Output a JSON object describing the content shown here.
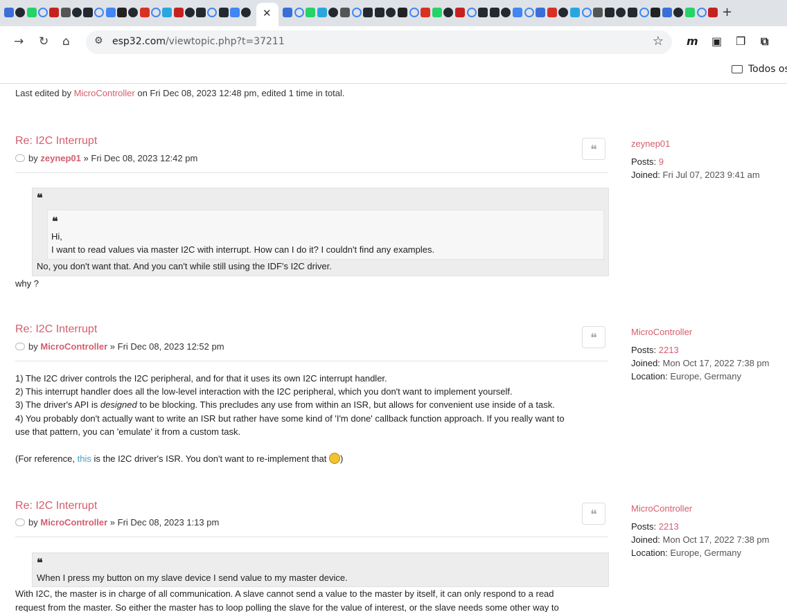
{
  "browser": {
    "active_tab_close": "✕",
    "new_tab": "+",
    "url_host": "esp32.com",
    "url_path": "/viewtopic.php?t=37211",
    "bookmark_folder": "Todos os"
  },
  "top_note": {
    "prefix": "Last edited by",
    "author": "MicroController",
    "suffix": "on Fri Dec 08, 2023 12:48 pm, edited 1 time in total."
  },
  "posts": [
    {
      "title": "Re: I2C Interrupt",
      "by": "by",
      "author": "zeynep01",
      "date": "» Fri Dec 08, 2023 12:42 pm",
      "profile": {
        "name": "zeynep01",
        "posts_label": "Posts:",
        "posts": "9",
        "joined_label": "Joined:",
        "joined": "Fri Jul 07, 2023 9:41 am"
      },
      "outer_quote_last": "No, you don't want that. And you can't while still using the IDF's I2C driver.",
      "inner_quote": [
        "Hi,",
        "I want to read values via master I2C with interrupt. How can I do it? I couldn't find any examples."
      ],
      "body": "why ?"
    },
    {
      "title": "Re: I2C Interrupt",
      "by": "by",
      "author": "MicroController",
      "date": "» Fri Dec 08, 2023 12:52 pm",
      "profile": {
        "name": "MicroController",
        "posts_label": "Posts:",
        "posts": "2213",
        "joined_label": "Joined:",
        "joined": "Mon Oct 17, 2022 7:38 pm",
        "location_label": "Location:",
        "location": "Europe, Germany"
      },
      "lines": [
        "1) The I2C driver controls the I2C peripheral, and for that it uses its own I2C interrupt handler.",
        "2) This interrupt handler does all the low-level interaction with the I2C peripheral, which you don't want to implement yourself.",
        "4) You probably don't actually want to write an ISR but rather have some kind of 'I'm done' callback function approach. If you really want to",
        "use that pattern, you can 'emulate' it from a custom task."
      ],
      "line3_a": "3) The driver's API is",
      "line3_em": "designed",
      "line3_b": "to be blocking. This precludes any use from within an ISR, but allows for convenient use inside of a task.",
      "ref_a": "(For reference,",
      "ref_link": "this",
      "ref_b": "is the I2C driver's ISR. You don't want to re-implement that",
      "ref_end": ")"
    },
    {
      "title": "Re: I2C Interrupt",
      "by": "by",
      "author": "MicroController",
      "date": "» Fri Dec 08, 2023 1:13 pm",
      "profile": {
        "name": "MicroController",
        "posts_label": "Posts:",
        "posts": "2213",
        "joined_label": "Joined:",
        "joined": "Mon Oct 17, 2022 7:38 pm",
        "location_label": "Location:",
        "location": "Europe, Germany"
      },
      "quote": "When I press my button on my slave device I send value to my master device.",
      "lines": [
        "With I2C, the master is in charge of all communication. A slave cannot send a value to the master by itself, it can only respond to a read",
        "request from the master. So either the master has to loop polling the slave for the value of interest, or the slave needs some other way to"
      ]
    }
  ],
  "colors": {
    "link": "#d35d6e",
    "accent_link": "#3ca0c8",
    "quote_bg": "#ededed"
  },
  "icons": [
    "back-arrow-icon",
    "reload-icon",
    "home-icon",
    "site-settings-icon",
    "star-icon",
    "folder-icon",
    "reply-icon",
    "quote-icon",
    "smiley-icon"
  ]
}
